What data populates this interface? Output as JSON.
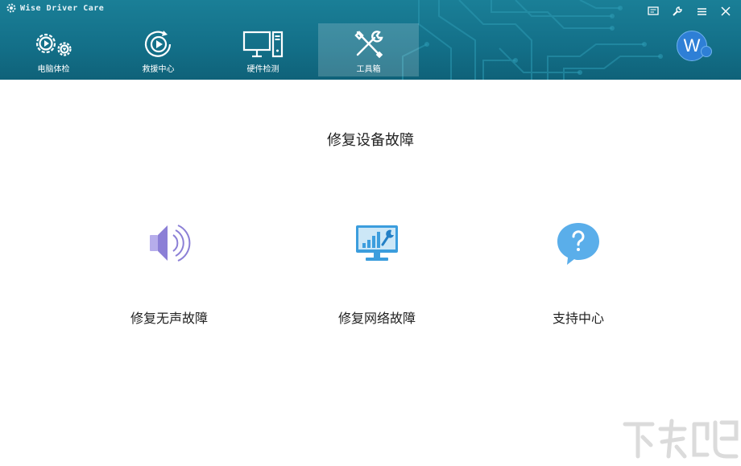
{
  "app": {
    "title": "Wise Driver Care"
  },
  "nav": {
    "items": [
      {
        "label": "电脑体检",
        "icon": "gears-play-icon"
      },
      {
        "label": "救援中心",
        "icon": "rescue-play-icon"
      },
      {
        "label": "硬件检测",
        "icon": "computer-hardware-icon"
      },
      {
        "label": "工具箱",
        "icon": "tools-wrench-screwdriver-icon"
      }
    ],
    "active_index": 3
  },
  "window_controls": [
    "feedback-icon",
    "settings-wrench-icon",
    "menu-icon",
    "close-icon"
  ],
  "avatar": {
    "letter": "W"
  },
  "main": {
    "title": "修复设备故障",
    "tools": [
      {
        "label": "修复无声故障",
        "icon": "speaker-icon"
      },
      {
        "label": "修复网络故障",
        "icon": "monitor-network-icon"
      },
      {
        "label": "支持中心",
        "icon": "help-bubble-icon"
      }
    ]
  },
  "colors": {
    "header": "#136f88",
    "speaker": "#8b7fd6",
    "network": "#3b9ddd",
    "help": "#5aaeea"
  }
}
